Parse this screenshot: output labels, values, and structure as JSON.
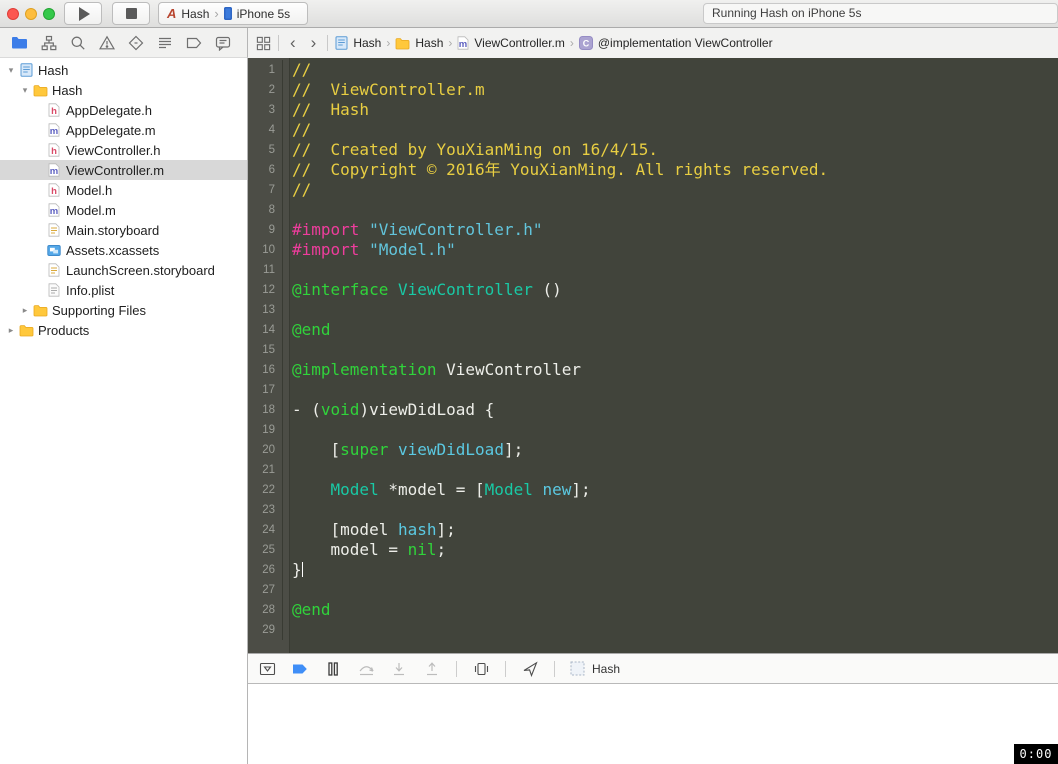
{
  "colors": {
    "editor_background": "#41443B",
    "gutter_background": "#4C4D46",
    "line_number": "#9A9C96",
    "selection_background": "#D8D8D8",
    "breakpoint_blue": "#3F8EF7",
    "navigator_selected_blue": "#3C7DE8",
    "syntax": {
      "comment": "#E8CE42",
      "preprocessor": "#EE3D9C",
      "string": "#62C5DC",
      "keyword": "#30D33B",
      "class_name": "#19C9A5",
      "method": "#5BC9E2",
      "plain": "#EDEEE9"
    }
  },
  "toolbar": {
    "scheme": {
      "project": "Hash",
      "destination": "iPhone 5s"
    },
    "status": "Running Hash on iPhone 5s"
  },
  "navigator": {
    "tabs": [
      "project",
      "symbols",
      "search",
      "issues",
      "tests",
      "debug",
      "breakpoints",
      "reports"
    ],
    "selected": "project"
  },
  "sidebar": {
    "items": [
      {
        "label": "Hash",
        "icon": "project",
        "indent": 0,
        "disclosure": "open"
      },
      {
        "label": "Hash",
        "icon": "folder",
        "indent": 1,
        "disclosure": "open"
      },
      {
        "label": "AppDelegate.h",
        "icon": "h",
        "indent": 2
      },
      {
        "label": "AppDelegate.m",
        "icon": "m",
        "indent": 2
      },
      {
        "label": "ViewController.h",
        "icon": "h",
        "indent": 2
      },
      {
        "label": "ViewController.m",
        "icon": "m",
        "indent": 2,
        "selected": true
      },
      {
        "label": "Model.h",
        "icon": "h",
        "indent": 2
      },
      {
        "label": "Model.m",
        "icon": "m",
        "indent": 2
      },
      {
        "label": "Main.storyboard",
        "icon": "storyboard",
        "indent": 2
      },
      {
        "label": "Assets.xcassets",
        "icon": "assets",
        "indent": 2
      },
      {
        "label": "LaunchScreen.storyboard",
        "icon": "storyboard",
        "indent": 2
      },
      {
        "label": "Info.plist",
        "icon": "plist",
        "indent": 2
      },
      {
        "label": "Supporting Files",
        "icon": "folder",
        "indent": 1,
        "disclosure": "closed"
      },
      {
        "label": "Products",
        "icon": "folder",
        "indent": 0,
        "disclosure": "closed"
      }
    ]
  },
  "jumpbar": {
    "crumbs": [
      {
        "icon": "project",
        "label": "Hash"
      },
      {
        "icon": "folder",
        "label": "Hash"
      },
      {
        "icon": "m",
        "label": "ViewController.m"
      },
      {
        "icon": "c",
        "label": "@implementation ViewController"
      }
    ]
  },
  "editor": {
    "cursor_line": 26,
    "lines": [
      {
        "n": 1,
        "tokens": [
          [
            "com",
            "//"
          ]
        ]
      },
      {
        "n": 2,
        "tokens": [
          [
            "com",
            "//  ViewController.m"
          ]
        ]
      },
      {
        "n": 3,
        "tokens": [
          [
            "com",
            "//  Hash"
          ]
        ]
      },
      {
        "n": 4,
        "tokens": [
          [
            "com",
            "//"
          ]
        ]
      },
      {
        "n": 5,
        "tokens": [
          [
            "com",
            "//  Created by YouXianMing on 16/4/15."
          ]
        ]
      },
      {
        "n": 6,
        "tokens": [
          [
            "com",
            "//  Copyright © 2016年 YouXianMing. All rights reserved."
          ]
        ]
      },
      {
        "n": 7,
        "tokens": [
          [
            "com",
            "//"
          ]
        ]
      },
      {
        "n": 8,
        "tokens": []
      },
      {
        "n": 9,
        "tokens": [
          [
            "pre",
            "#import "
          ],
          [
            "str",
            "\"ViewController.h\""
          ]
        ]
      },
      {
        "n": 10,
        "tokens": [
          [
            "pre",
            "#import "
          ],
          [
            "str",
            "\"Model.h\""
          ]
        ]
      },
      {
        "n": 11,
        "tokens": []
      },
      {
        "n": 12,
        "tokens": [
          [
            "kw",
            "@interface"
          ],
          [
            "pln",
            " "
          ],
          [
            "cls",
            "ViewController"
          ],
          [
            "pln",
            " ()"
          ]
        ]
      },
      {
        "n": 13,
        "tokens": []
      },
      {
        "n": 14,
        "tokens": [
          [
            "kw",
            "@end"
          ]
        ]
      },
      {
        "n": 15,
        "tokens": []
      },
      {
        "n": 16,
        "tokens": [
          [
            "kw",
            "@implementation"
          ],
          [
            "pln",
            " ViewController"
          ]
        ]
      },
      {
        "n": 17,
        "tokens": []
      },
      {
        "n": 18,
        "tokens": [
          [
            "pln",
            "- ("
          ],
          [
            "kw",
            "void"
          ],
          [
            "pln",
            ")viewDidLoad {"
          ]
        ]
      },
      {
        "n": 19,
        "tokens": []
      },
      {
        "n": 20,
        "tokens": [
          [
            "pln",
            "    ["
          ],
          [
            "kw",
            "super"
          ],
          [
            "pln",
            " "
          ],
          [
            "mth",
            "viewDidLoad"
          ],
          [
            "pln",
            "];"
          ]
        ]
      },
      {
        "n": 21,
        "tokens": []
      },
      {
        "n": 22,
        "tokens": [
          [
            "pln",
            "    "
          ],
          [
            "cls",
            "Model"
          ],
          [
            "pln",
            " *model = ["
          ],
          [
            "cls",
            "Model"
          ],
          [
            "pln",
            " "
          ],
          [
            "mth",
            "new"
          ],
          [
            "pln",
            "];"
          ]
        ]
      },
      {
        "n": 23,
        "tokens": []
      },
      {
        "n": 24,
        "tokens": [
          [
            "pln",
            "    [model "
          ],
          [
            "mth",
            "hash"
          ],
          [
            "pln",
            "];"
          ]
        ]
      },
      {
        "n": 25,
        "tokens": [
          [
            "pln",
            "    model = "
          ],
          [
            "kw",
            "nil"
          ],
          [
            "pln",
            ";"
          ]
        ]
      },
      {
        "n": 26,
        "tokens": [
          [
            "pln",
            "}"
          ]
        ]
      },
      {
        "n": 27,
        "tokens": []
      },
      {
        "n": 28,
        "tokens": [
          [
            "kw",
            "@end"
          ]
        ]
      },
      {
        "n": 29,
        "tokens": []
      }
    ]
  },
  "debugbar": {
    "buttons": [
      "hide-debug-area",
      "breakpoints-toggle",
      "pause",
      "step-over",
      "step-into",
      "step-out",
      "debug-view-hierarchy",
      "simulate-location"
    ],
    "process": "Hash"
  },
  "overlay": {
    "timer": "0:00"
  }
}
